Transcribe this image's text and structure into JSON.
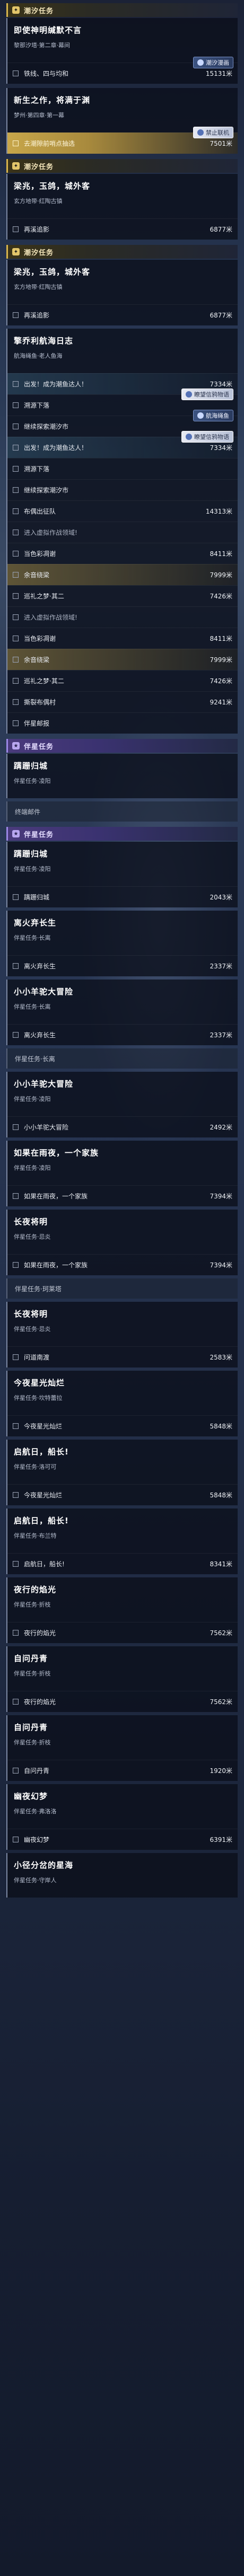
{
  "colors": {
    "gold": "#d8b54c",
    "purple": "#9c88e6",
    "active": "#c7a64a"
  },
  "sections": {
    "s1": "潮汐任务",
    "s2": "潮汐任务",
    "s3": "潮汐任务",
    "s4": "伴星任务",
    "s5": "伴星任务"
  },
  "q1": {
    "title": "即使神明缄默不言",
    "sub": "黎那汐塔·第二章·幕间",
    "badge": "潮汐漫画",
    "rows": [
      {
        "label": "铁线、四与均和",
        "dist": "15131米"
      }
    ]
  },
  "q2": {
    "title": "新生之作，将满于渊",
    "sub": "梦州·第四章·第一幕",
    "badge": "禁止联机",
    "rows": [
      {
        "label": "去潮隙前哨点抽选",
        "dist": "7501米"
      }
    ]
  },
  "q3": {
    "title": "梁兆，玉鸽，城外客",
    "sub": "玄方地带·红陶古镇",
    "rows": [
      {
        "label": "再溪追影",
        "dist": "6877米"
      }
    ]
  },
  "q4": {
    "title": "梁兆，玉鸽，城外客",
    "sub": "玄方地带·红陶古镇",
    "rows": [
      {
        "label": "再溪追影",
        "dist": "6877米"
      }
    ]
  },
  "q5": {
    "title": "擎乔利航海日志",
    "sub": "航海绳鱼·老人鱼海",
    "chip1": "航海绳鱼",
    "chip2": "瞭望信鸦物语",
    "chip3": "航海绳鱼",
    "chip4": "瞭望信鸦物语",
    "rows": [
      {
        "label": "出发！成为潮鱼达人！",
        "dist": "7334米"
      },
      {
        "label": "溯源下落",
        "dist": ""
      },
      {
        "label": "继续探索潮汐市",
        "dist": ""
      },
      {
        "label": "出发！成为潮鱼达人！",
        "dist": "7334米"
      },
      {
        "label": "溯源下落",
        "dist": ""
      },
      {
        "label": "继续探索潮汐市",
        "dist": ""
      },
      {
        "label": "布偶出征队",
        "dist": "14313米"
      },
      {
        "label": "进入虚拟作战领域!",
        "dist": ""
      },
      {
        "label": "当色彩凋谢",
        "dist": "8411米"
      },
      {
        "label": "余音绕梁",
        "dist": "7999米"
      },
      {
        "label": "巡礼之梦·其二",
        "dist": "7426米"
      },
      {
        "label": "进入虚拟作战领域!",
        "dist": ""
      },
      {
        "label": "当色彩凋谢",
        "dist": "8411米"
      },
      {
        "label": "余音绕梁",
        "dist": "7999米"
      },
      {
        "label": "巡礼之梦·其二",
        "dist": "7426米"
      },
      {
        "label": "撕裂布偶村",
        "dist": "9241米"
      },
      {
        "label": "伴星邮报",
        "dist": ""
      }
    ]
  },
  "c1": {
    "title": "蹒跚归城",
    "sub": "伴星任务·凌阳"
  },
  "minor1": "终端邮件",
  "c2": {
    "title": "蹒跚归城",
    "sub": "伴星任务·凌阳",
    "rows": [
      {
        "label": "蹒跚归城",
        "dist": "2043米"
      }
    ]
  },
  "c3": {
    "title": "离火弃长生",
    "sub": "伴星任务·长离",
    "rows": [
      {
        "label": "离火弃长生",
        "dist": "2337米"
      }
    ]
  },
  "c4": {
    "title": "小小羊驼大冒险",
    "sub": "伴星任务·长离",
    "rows": [
      {
        "label": "离火弃长生",
        "dist": "2337米"
      }
    ]
  },
  "minor2": "伴星任务·长离",
  "c5": {
    "title": "小小羊驼大冒险",
    "sub": "伴星任务·凌阳",
    "rows": [
      {
        "label": "小小羊驼大冒险",
        "dist": "2492米"
      }
    ]
  },
  "c6": {
    "title": "如果在雨夜，一个家族",
    "sub": "伴星任务·凌阳",
    "rows": [
      {
        "label": "如果在雨夜，一个家族",
        "dist": "7394米"
      }
    ]
  },
  "c7": {
    "title": "长夜将明",
    "sub": "伴星任务·忌炎",
    "rows": [
      {
        "label": "如果在雨夜，一个家族",
        "dist": "7394米"
      }
    ]
  },
  "minor3": "伴星任务·珂莱塔",
  "c8": {
    "title": "长夜将明",
    "sub": "伴星任务·忌炎",
    "rows": [
      {
        "label": "问道南渡",
        "dist": "2583米"
      }
    ]
  },
  "c9": {
    "title": "今夜星光灿烂",
    "sub": "伴星任务·坎特蕾拉",
    "rows": [
      {
        "label": "今夜星光灿烂",
        "dist": "5848米"
      }
    ]
  },
  "c10": {
    "title": "启航日，船长!",
    "sub": "伴星任务·洛可可",
    "rows": [
      {
        "label": "今夜星光灿烂",
        "dist": "5848米"
      }
    ]
  },
  "c11": {
    "title": "启航日，船长!",
    "sub": "伴星任务·布兰特",
    "rows": [
      {
        "label": "启航日，船长!",
        "dist": "8341米"
      }
    ]
  },
  "c12": {
    "title": "夜行的焰光",
    "sub": "伴星任务·折枝",
    "rows": [
      {
        "label": "夜行的焰光",
        "dist": "7562米"
      }
    ]
  },
  "c13": {
    "title": "自问丹青",
    "sub": "伴星任务·折枝",
    "rows": [
      {
        "label": "夜行的焰光",
        "dist": "7562米"
      }
    ]
  },
  "c14": {
    "title": "自问丹青",
    "sub": "伴星任务·折枝",
    "rows": [
      {
        "label": "自问丹青",
        "dist": "1920米"
      }
    ]
  },
  "c15": {
    "title": "幽夜幻梦",
    "sub": "伴星任务·弗洛洛",
    "rows": [
      {
        "label": "幽夜幻梦",
        "dist": "6391米"
      }
    ]
  },
  "c16": {
    "title": "小径分岔的星海",
    "sub": "伴星任务·守岸人"
  }
}
